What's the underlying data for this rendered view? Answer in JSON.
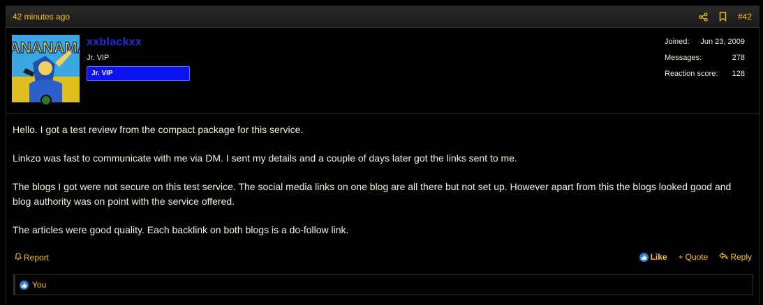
{
  "header": {
    "timestamp": "42 minutes ago",
    "post_number": "#42"
  },
  "user": {
    "name": "xxblackxx",
    "title": "Jr. VIP",
    "banner": "Jr. VIP",
    "online": true
  },
  "stats": [
    {
      "label": "Joined:",
      "value": "Jun 23, 2009"
    },
    {
      "label": "Messages:",
      "value": "278"
    },
    {
      "label": "Reaction score:",
      "value": "128"
    }
  ],
  "message": {
    "paragraphs": [
      "Hello. I got a test review from the compact package for this service.",
      "Linkzo was fast to communicate with me via DM. I sent my details and a couple of days later got the links sent to me.",
      "The blogs I got were not secure on this test service. The social media links on one blog are all there but not set up. However apart from this the blogs looked good and blog authority was on point with the service offered.",
      "The articles were good quality. Each backlink on both blogs is a do-follow link."
    ]
  },
  "actions": {
    "report": "Report",
    "like": "Like",
    "quote": "Quote",
    "reply": "Reply"
  },
  "reactions": {
    "summary": "You"
  },
  "colors": {
    "accent": "#f5c21b",
    "username": "#1e2fe0",
    "banner": "#0c11ef",
    "like": "#2a7fd4"
  }
}
